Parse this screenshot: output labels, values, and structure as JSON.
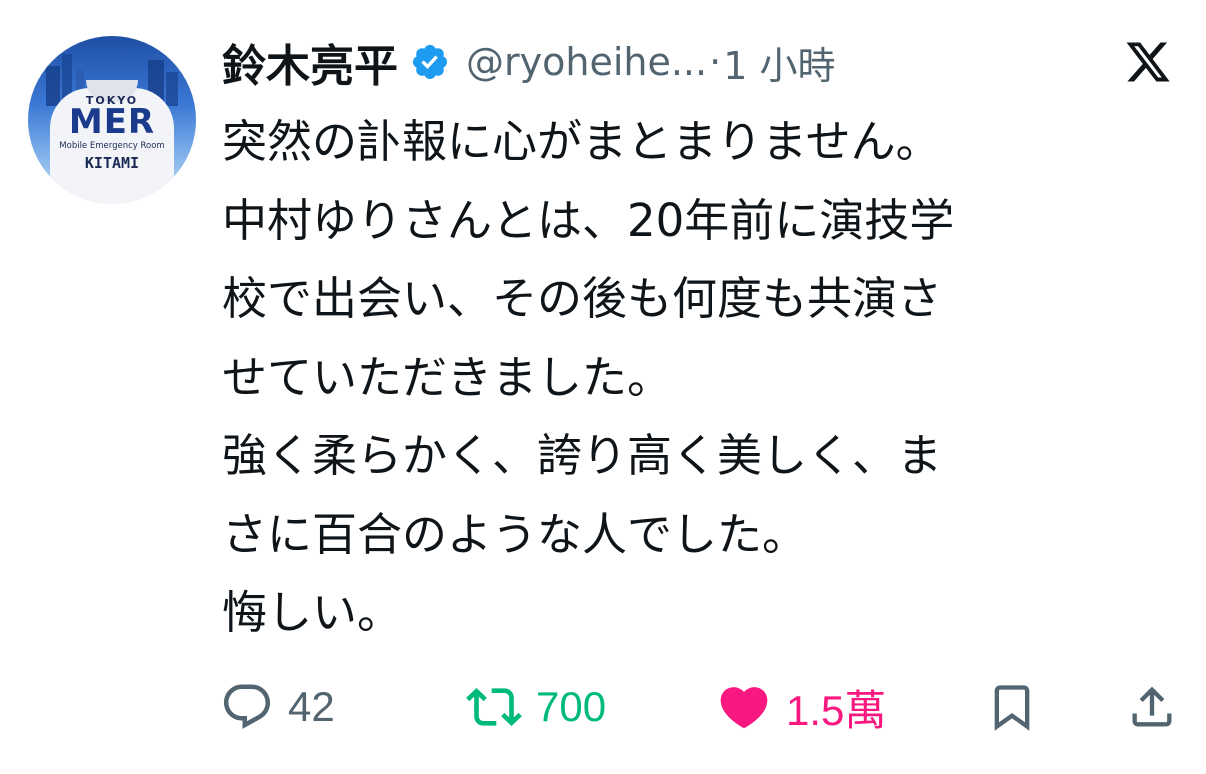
{
  "author": {
    "display_name": "鈴木亮平",
    "handle": "@ryoheihe...",
    "separator": "·",
    "time": "1 小時",
    "verified": true,
    "avatar": {
      "top_text": "TOKYO",
      "main_text": "MER",
      "sub_text": "Mobile Emergency Room",
      "name_text": "KITAMI"
    }
  },
  "platform_icon": "x-logo-icon",
  "tweet": {
    "lines": [
      "突然の訃報に心がまとまりません。",
      "中村ゆりさんとは、20年前に演技学",
      "校で出会い、その後も何度も共演さ",
      "せていただきました。",
      "強く柔らかく、誇り高く美しく、ま",
      "さに百合のような人でした。",
      "悔しい。"
    ]
  },
  "actions": {
    "reply": {
      "icon": "reply-icon",
      "count": "42"
    },
    "retweet": {
      "icon": "retweet-icon",
      "count": "700"
    },
    "like": {
      "icon": "heart-icon",
      "count": "1.5萬",
      "liked": true
    },
    "bookmark": {
      "icon": "bookmark-icon"
    },
    "share": {
      "icon": "share-icon"
    }
  },
  "colors": {
    "text": "#0f1419",
    "secondary": "#536471",
    "verified": "#1d9bf0",
    "retweet": "#00ba7c",
    "like": "#f91880"
  }
}
